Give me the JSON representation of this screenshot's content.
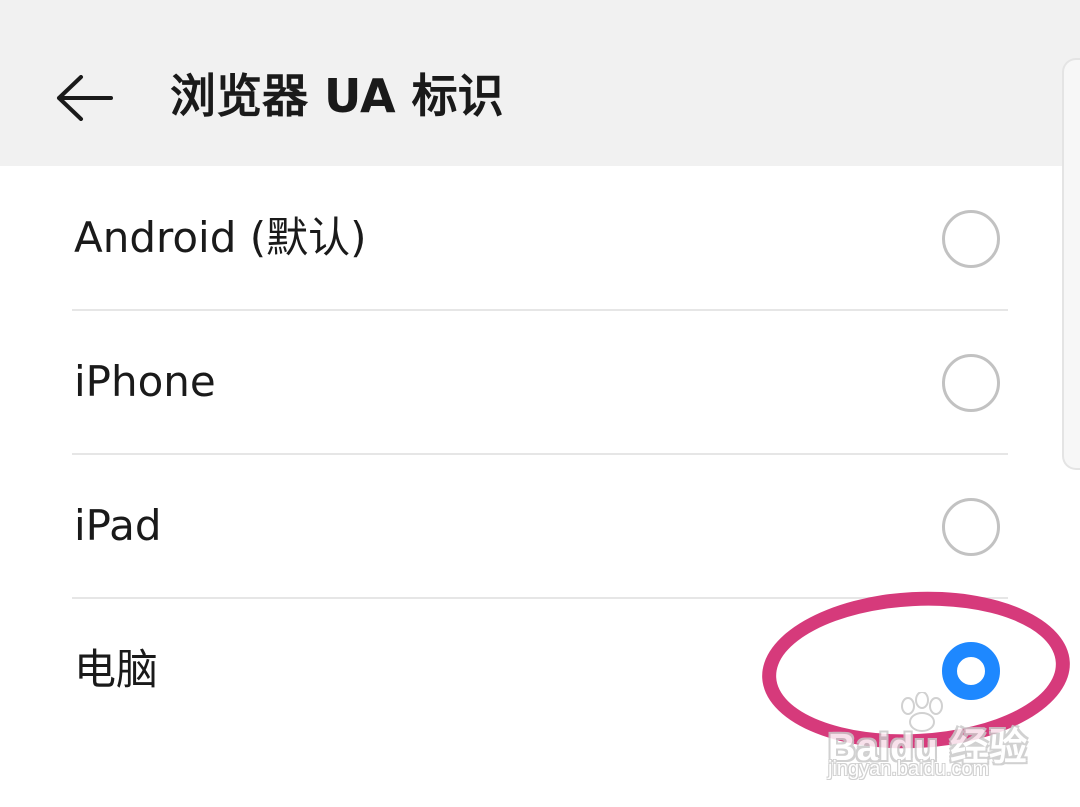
{
  "header": {
    "title": "浏览器 UA 标识",
    "back_icon": "arrow-left-icon"
  },
  "options": [
    {
      "label": "Android (默认)",
      "selected": false
    },
    {
      "label": "iPhone",
      "selected": false
    },
    {
      "label": "iPad",
      "selected": false
    },
    {
      "label": "电脑",
      "selected": true
    }
  ],
  "colors": {
    "header_bg": "#f1f1f1",
    "accent": "#1e88ff",
    "highlight_ring": "#d63a7b",
    "radio_border": "#c2c2c2"
  },
  "watermark": {
    "brand": "Baidu 经验",
    "url": "jingyan.baidu.com"
  }
}
